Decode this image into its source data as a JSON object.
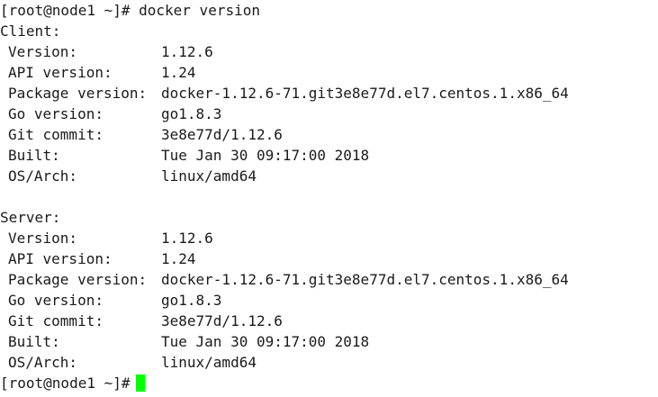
{
  "terminal": {
    "command_line": "[root@node1 ~]# docker version",
    "client": {
      "heading": "Client:",
      "fields": [
        {
          "key": "Version:",
          "value": "1.12.6"
        },
        {
          "key": "API version:",
          "value": "1.24"
        },
        {
          "key": "Package version:",
          "value": "docker-1.12.6-71.git3e8e77d.el7.centos.1.x86_64"
        },
        {
          "key": "Go version:",
          "value": "go1.8.3"
        },
        {
          "key": "Git commit:",
          "value": "3e8e77d/1.12.6"
        },
        {
          "key": "Built:",
          "value": "Tue Jan 30 09:17:00 2018"
        },
        {
          "key": "OS/Arch:",
          "value": "linux/amd64"
        }
      ]
    },
    "server": {
      "heading": "Server:",
      "fields": [
        {
          "key": "Version:",
          "value": "1.12.6"
        },
        {
          "key": "API version:",
          "value": "1.24"
        },
        {
          "key": "Package version:",
          "value": "docker-1.12.6-71.git3e8e77d.el7.centos.1.x86_64"
        },
        {
          "key": "Go version:",
          "value": "go1.8.3"
        },
        {
          "key": "Git commit:",
          "value": "3e8e77d/1.12.6"
        },
        {
          "key": "Built:",
          "value": "Tue Jan 30 09:17:00 2018"
        },
        {
          "key": "OS/Arch:",
          "value": "linux/amd64"
        }
      ]
    },
    "prompt": "[root@node1 ~]#",
    "cursor_color": "#00ff00"
  }
}
